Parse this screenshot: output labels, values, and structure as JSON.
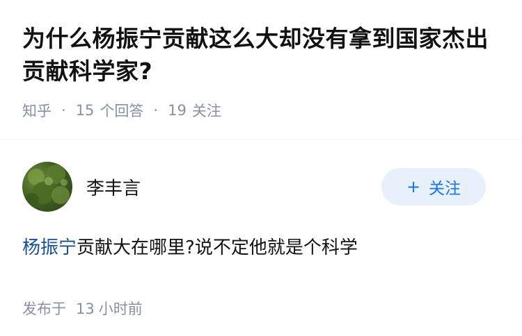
{
  "question": {
    "title": "为什么杨振宁贡献这么大却没有拿到国家杰出贡献科学家?",
    "source": "知乎",
    "answer_count": "15",
    "answer_label": "个回答",
    "follower_count": "19",
    "follower_label": "关注"
  },
  "answer": {
    "author_name": "李丰言",
    "follow_label": "关注",
    "follow_plus": "+",
    "link_text": "杨振宁",
    "body_text": "贡献大在哪里?说不定他就是个科学",
    "published_label": "发布于",
    "published_num": "13",
    "published_unit": "小时前"
  },
  "colors": {
    "link": "#175199",
    "accent": "#1772f6",
    "meta": "#8590a6"
  }
}
